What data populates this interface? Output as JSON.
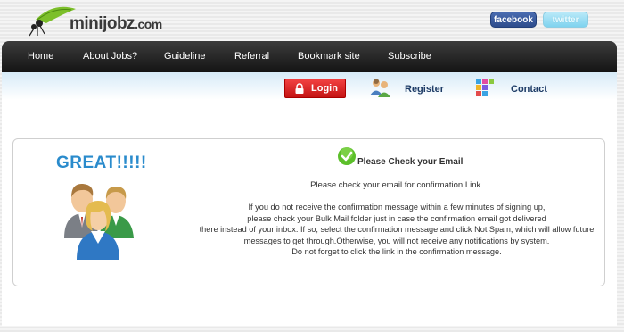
{
  "header": {
    "logo": {
      "word_a": "mini",
      "word_b": "jobz",
      "suffix": ".com"
    },
    "social": {
      "facebook": "facebook",
      "twitter": "twitter"
    }
  },
  "nav": {
    "items": [
      {
        "label": "Home"
      },
      {
        "label": "About Jobs?"
      },
      {
        "label": "Guideline"
      },
      {
        "label": "Referral"
      },
      {
        "label": "Bookmark site"
      },
      {
        "label": "Subscribe"
      }
    ]
  },
  "actions": {
    "login": "Login",
    "register": "Register",
    "contact": "Contact"
  },
  "content": {
    "banner": "GREAT!!!!!",
    "title": "Please Check your Email",
    "subtitle": "Please check your email for confirmation Link.",
    "lines": [
      "If you do not receive the confirmation message within a few minutes of signing up,",
      "please check your Bulk Mail folder just in case the confirmation email got delivered",
      "there instead of your inbox. If so, select the confirmation message and click Not Spam, which will allow future",
      "messages to get through.Otherwise, you will not receive any notifications by system.",
      "Do not forget to click the link in the confirmation message."
    ]
  },
  "icons": {
    "logo": "ant-logo-icon",
    "lock": "lock-icon",
    "register": "users-icon",
    "contact": "contact-blocks-icon",
    "check": "green-check-icon",
    "people": "people-group-icon"
  },
  "colors": {
    "nav_bg": "#1f1f1f",
    "login_red": "#e02a2a",
    "banner_blue": "#2a8bcc",
    "link_navy": "#1d3b66"
  }
}
